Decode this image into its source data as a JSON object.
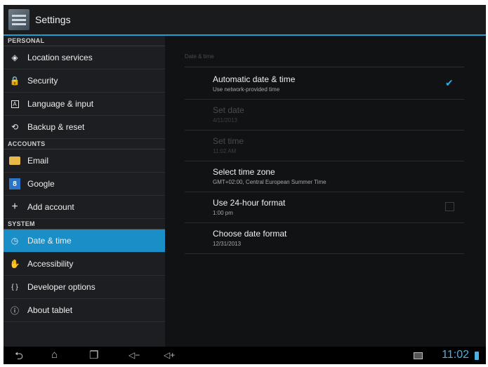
{
  "app": {
    "title": "Settings"
  },
  "sidebar": {
    "sections": [
      {
        "label": "PERSONAL",
        "items": [
          {
            "label": "Location services",
            "icon": "location-icon"
          },
          {
            "label": "Security",
            "icon": "lock-icon"
          },
          {
            "label": "Language & input",
            "icon": "language-icon"
          },
          {
            "label": "Backup & reset",
            "icon": "backup-icon"
          }
        ]
      },
      {
        "label": "ACCOUNTS",
        "items": [
          {
            "label": "Email",
            "icon": "email-icon"
          },
          {
            "label": "Google",
            "icon": "google-icon"
          },
          {
            "label": "Add account",
            "icon": "plus-icon"
          }
        ]
      },
      {
        "label": "SYSTEM",
        "items": [
          {
            "label": "Date & time",
            "icon": "clock-icon",
            "selected": true
          },
          {
            "label": "Accessibility",
            "icon": "hand-icon"
          },
          {
            "label": "Developer options",
            "icon": "braces-icon"
          },
          {
            "label": "About tablet",
            "icon": "info-icon"
          }
        ]
      }
    ]
  },
  "detail": {
    "header": "Date & time",
    "prefs": [
      {
        "title": "Automatic date & time",
        "summary": "Use network-provided time",
        "checkbox": true,
        "checked": true,
        "enabled": true
      },
      {
        "title": "Set date",
        "summary": "4/11/2013",
        "enabled": false
      },
      {
        "title": "Set time",
        "summary": "11:02 AM",
        "enabled": false
      },
      {
        "title": "Select time zone",
        "summary": "GMT+02:00, Central European Summer Time",
        "enabled": true
      },
      {
        "title": "Use 24-hour format",
        "summary": "1:00 pm",
        "checkbox": true,
        "checked": false,
        "enabled": true
      },
      {
        "title": "Choose date format",
        "summary": "12/31/2013",
        "enabled": true
      }
    ]
  },
  "statusbar": {
    "clock": "11:02"
  },
  "colors": {
    "accent": "#1a8fc7",
    "highlight": "#34a9e0",
    "background": "#111214"
  }
}
